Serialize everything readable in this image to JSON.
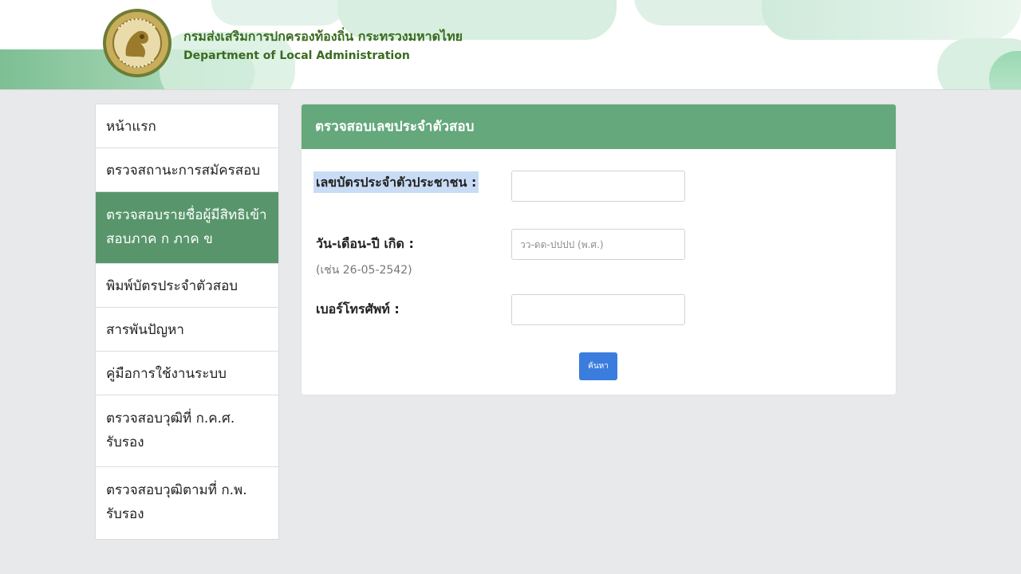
{
  "header": {
    "title_th": "กรมส่งเสริมการปกครองท้องถิ่น กระทรวงมหาดไทย",
    "title_en": "Department of Local Administration",
    "logo_icon": "dla-emblem-icon",
    "logo_colors": {
      "gold": "#b99a45",
      "green": "#3a6b1f"
    }
  },
  "sidebar": {
    "items": [
      {
        "label": "หน้าแรก"
      },
      {
        "label": "ตรวจสถานะการสมัครสอบ"
      },
      {
        "label_line1": "ตรวจสอบรายชื่อผู้มีสิทธิเข้า",
        "label_line2": "สอบภาค ก ภาค ข",
        "active": true
      },
      {
        "label": "พิมพ์บัตรประจำตัวสอบ"
      },
      {
        "label": "สารพันปัญหา"
      },
      {
        "label": "คู่มือการใช้งานระบบ"
      },
      {
        "label_line1": "ตรวจสอบวุฒิที่ ก.ค.ศ.",
        "label_line2": "รับรอง"
      },
      {
        "label_line1": "ตรวจสอบวุฒิตามที่ ก.พ.",
        "label_line2": "รับรอง"
      }
    ],
    "active_color": "#58956b"
  },
  "form": {
    "title": "ตรวจสอบเลขประจำตัวสอบ",
    "header_color": "#64a87c",
    "id_card_label": "เลขบัตรประจำตัวประชาชน :",
    "id_card_value": "",
    "birthdate_label": "วัน-เดือน-ปี เกิด :",
    "birthdate_hint": "(เช่น 26-05-2542)",
    "birthdate_placeholder": "วว-ดด-ปปปป (พ.ศ.)",
    "birthdate_value": "",
    "phone_label": "เบอร์โทรศัพท์ :",
    "phone_value": "",
    "search_label": "ค้นหา",
    "search_color": "#3b7ddd"
  }
}
